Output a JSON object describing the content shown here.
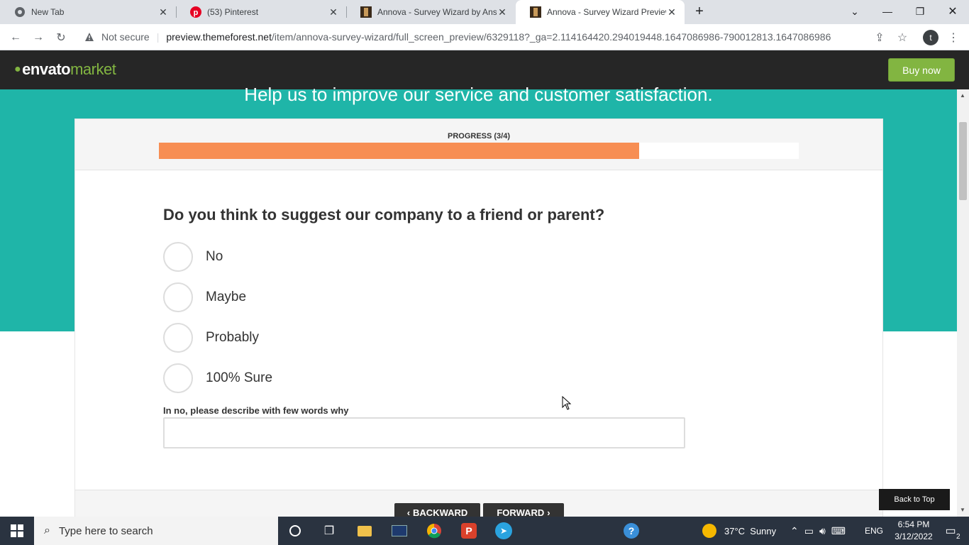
{
  "browser": {
    "tabs": [
      {
        "title": "New Tab",
        "icon": "chrome-icon"
      },
      {
        "title": "(53) Pinterest",
        "icon": "pinterest-icon"
      },
      {
        "title": "Annova - Survey Wizard by Anso",
        "icon": "annova-icon"
      },
      {
        "title": "Annova - Survey Wizard Preview",
        "icon": "annova-icon",
        "active": true
      }
    ],
    "security_label": "Not secure",
    "url_host": "preview.themeforest.net",
    "url_path": "/item/annova-survey-wizard/full_screen_preview/6329118?_ga=2.114164420.294019448.1647086986-790012813.1647086986",
    "profile_initial": "t"
  },
  "envato": {
    "logo_part1": "envato",
    "logo_part2": "market",
    "buy_label": "Buy now",
    "brand_color": "#82b541"
  },
  "hero": {
    "headline": "Help us to improve our service and customer satisfaction.",
    "color": "#1fb5a8"
  },
  "survey": {
    "progress_label": "PROGRESS (3/4)",
    "progress_fraction": 0.75,
    "progress_color": "#f78e53",
    "question": "Do you think to suggest our company to a friend or parent?",
    "options": [
      "No",
      "Maybe",
      "Probably",
      "100% Sure"
    ],
    "note_label": "In no, please describe with few words why",
    "note_value": "",
    "backward_label": "BACKWARD",
    "forward_label": "FORWARD"
  },
  "page": {
    "back_to_top": "Back to Top"
  },
  "taskbar": {
    "search_placeholder": "Type here to search",
    "weather": "37°C  Sunny",
    "lang": "ENG",
    "time": "6:54 PM",
    "date": "3/12/2022",
    "notif_count": "2"
  }
}
